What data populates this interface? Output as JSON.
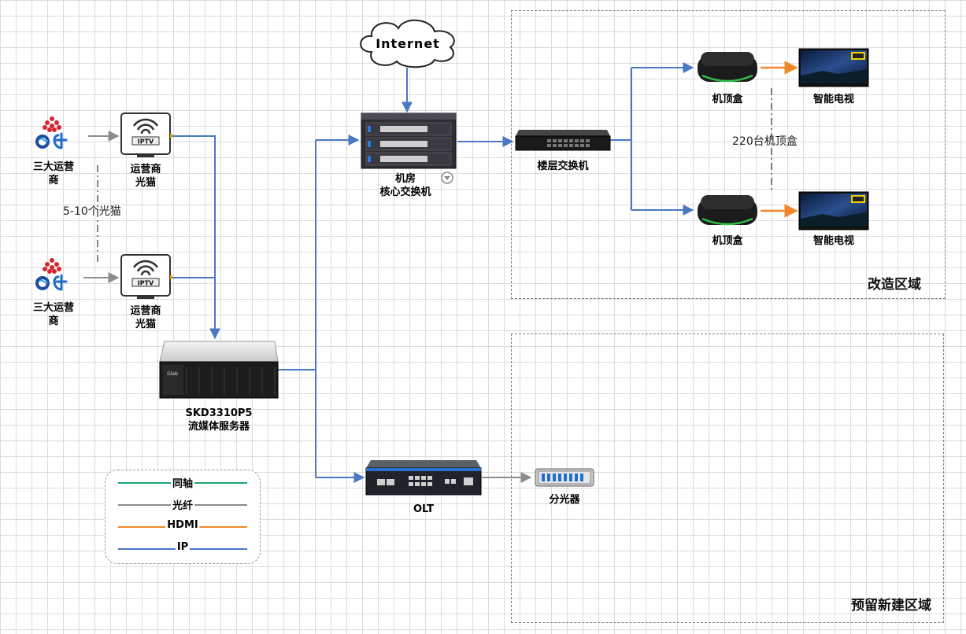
{
  "cloud": {
    "label": "Internet"
  },
  "carriers": [
    {
      "label_line1": "三大运营",
      "label_line2": "商"
    },
    {
      "label_line1": "三大运营",
      "label_line2": "商"
    }
  ],
  "modems": [
    {
      "label_line1": "运营商",
      "label_line2": "光猫",
      "screen_text": "IPTV"
    },
    {
      "label_line1": "运营商",
      "label_line2": "光猫",
      "screen_text": "IPTV"
    }
  ],
  "modem_count_note": "5-10个光猫",
  "streaming_server": {
    "label_line1": "SKD3310P5",
    "label_line2": "流媒体服务器",
    "panel_text": "Glab"
  },
  "core_switch": {
    "label_line1": "机房",
    "label_line2": "核心交换机"
  },
  "floor_switch": {
    "label": "楼层交换机"
  },
  "stb_top": {
    "label": "机顶盒"
  },
  "stb_bottom": {
    "label": "机顶盒"
  },
  "tv_top": {
    "label": "智能电视"
  },
  "tv_bottom": {
    "label": "智能电视"
  },
  "stb_count_note": "220台机顶盒",
  "olt": {
    "label": "OLT"
  },
  "splitter": {
    "label": "分光器"
  },
  "zones": {
    "renovation": "改造区域",
    "reserved": "预留新建区域"
  },
  "legend": [
    {
      "label": "同轴",
      "color": "#1aa86a"
    },
    {
      "label": "光纤",
      "color": "#8c8c8c"
    },
    {
      "label": "HDMI",
      "color": "#f0882a"
    },
    {
      "label": "IP",
      "color": "#4a78c2"
    }
  ],
  "colors": {
    "ip": "#4a78c2",
    "fiber": "#8c8c8c",
    "hdmi": "#f0882a",
    "coax": "#1aa86a"
  }
}
